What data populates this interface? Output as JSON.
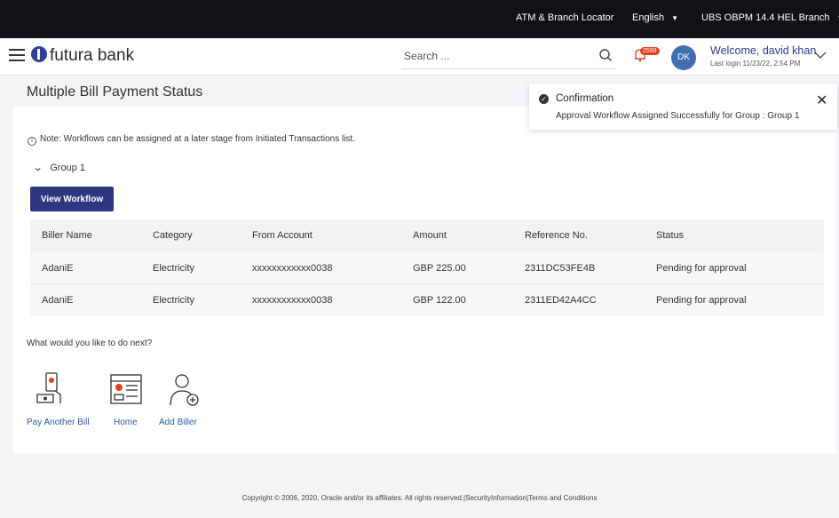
{
  "topbar": {
    "atm": "ATM & Branch Locator",
    "language": "English",
    "branch": "UBS OBPM 14.4 HEL Branch"
  },
  "header": {
    "brand": "futura bank",
    "search_placeholder": "Search ...",
    "notification_count": "2599",
    "avatar_initials": "DK",
    "welcome": "Welcome, david khan",
    "last_login": "Last login 11/23/22, 2:54 PM"
  },
  "page": {
    "title": "Multiple Bill Payment Status"
  },
  "toast": {
    "title": "Confirmation",
    "message": "Approval Workflow Assigned Successfully for Group : Group 1"
  },
  "note": "Note: Workflows can be assigned at a later stage from Initiated Transactions list.",
  "group": {
    "label": "Group 1",
    "workflow_button": "View Workflow"
  },
  "table": {
    "headers": [
      "Biller Name",
      "Category",
      "From Account",
      "Amount",
      "Reference No.",
      "Status"
    ],
    "rows": [
      [
        "AdaniE",
        "Electricity",
        "xxxxxxxxxxxx0038",
        "GBP 225.00",
        "2311DC53FE4B",
        "Pending for approval"
      ],
      [
        "AdaniE",
        "Electricity",
        "xxxxxxxxxxxx0038",
        "GBP 122.00",
        "2311ED42A4CC",
        "Pending for approval"
      ]
    ]
  },
  "next": {
    "title": "What would you like to do next?",
    "actions": [
      {
        "label": "Pay Another Bill",
        "icon": "bill-payment-icon"
      },
      {
        "label": "Home",
        "icon": "home-dashboard-icon"
      },
      {
        "label": "Add Biller",
        "icon": "add-biller-icon"
      }
    ]
  },
  "footer": "Copyright © 2006, 2020, Oracle and/or its affiliates. All rights reserved.|SecurityInformation|Terms and Conditions",
  "colors": {
    "topbar": "#101216",
    "primary_button": "#2f3680",
    "link": "#2c5aa8",
    "notification": "#e2421c"
  }
}
